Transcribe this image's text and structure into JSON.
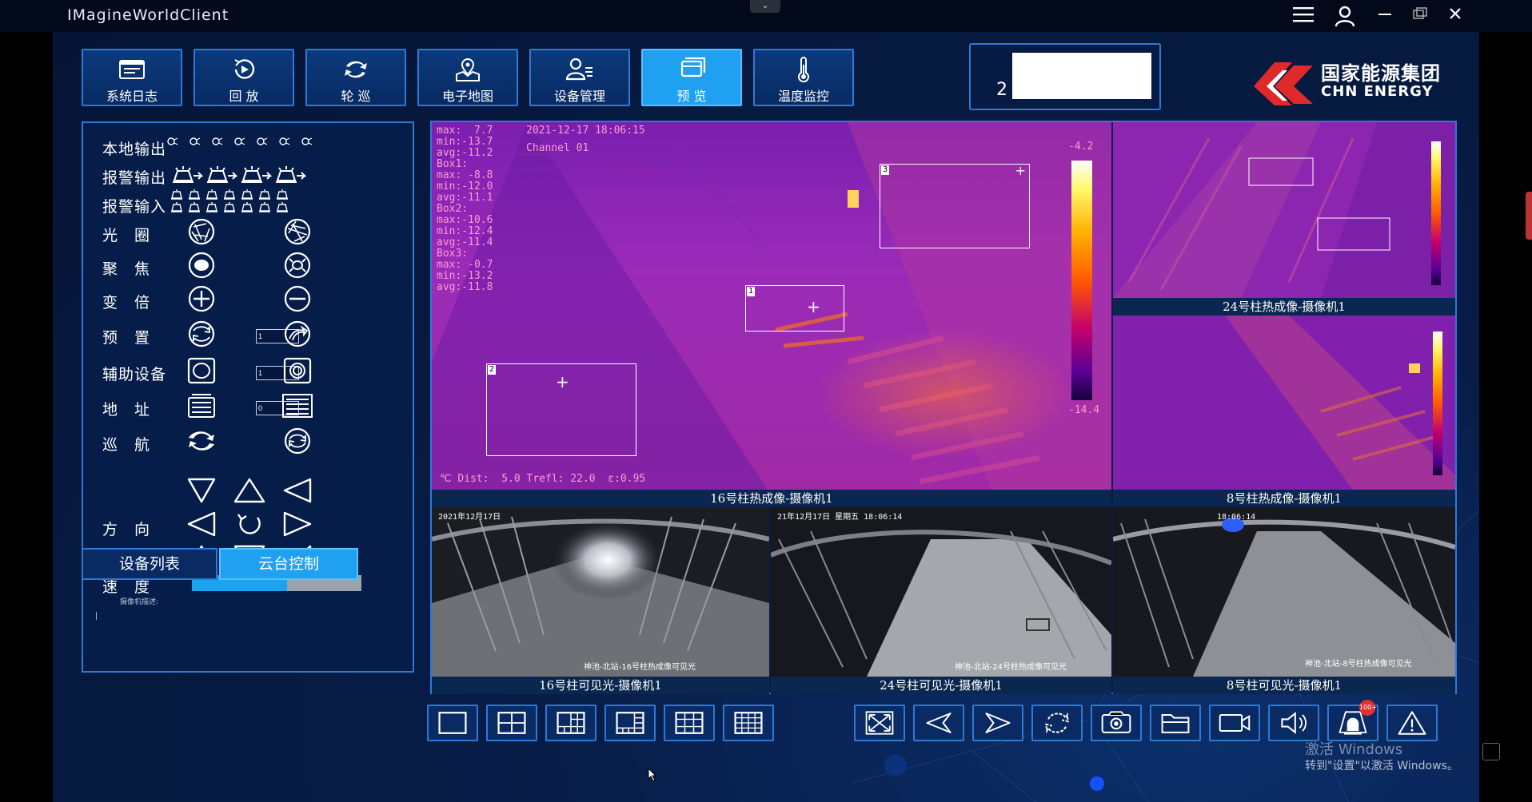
{
  "window": {
    "title": "IMagineWorldClient"
  },
  "nav": [
    {
      "label": "系统日志",
      "icon": "system-log-icon"
    },
    {
      "label": "回 放",
      "icon": "playback-icon"
    },
    {
      "label": "轮 巡",
      "icon": "patrol-icon"
    },
    {
      "label": "电子地图",
      "icon": "map-icon"
    },
    {
      "label": "设备管理",
      "icon": "device-manage-icon"
    },
    {
      "label": "预 览",
      "icon": "preview-icon",
      "active": true
    },
    {
      "label": "温度监控",
      "icon": "thermometer-icon"
    }
  ],
  "id_box": {
    "text": "2"
  },
  "logo": {
    "cn": "国家能源集团",
    "en": "CHN ENERGY",
    "color": "#e02a2a"
  },
  "ptz": {
    "rows": {
      "local_output": "本地输出",
      "alarm_output": "报警输出",
      "alarm_input": "报警输入",
      "iris": "光　圈",
      "focus": "聚　焦",
      "zoom": "变　倍",
      "preset": "预　置",
      "aux": "辅助设备",
      "address": "地　址",
      "cruise": "巡　航",
      "direction": "方　向",
      "speed": "速　度"
    },
    "preset_value": "1",
    "aux_value": "1",
    "address_value": "0",
    "speed_fraction": 0.56,
    "camera_desc": "摄像机描述:"
  },
  "tabs": {
    "device_list": "设备列表",
    "ptz_control": "云台控制"
  },
  "videos": {
    "main": {
      "label": "16号柱热成像-摄像机1",
      "osd_stats": "max:  7.7\nmin:-13.7\navg:-11.2\nBox1:\nmax: -8.8\nmin:-12.0\navg:-11.1\nBox2:\nmax:-10.6\nmin:-12.4\navg:-11.4\nBox3:\nmax: -0.7\nmin:-13.2\navg:-11.8",
      "datetime": "2021-12-17 18:06:15",
      "channel": "Channel 01",
      "scale_max": "-4.2",
      "scale_min": "-14.4",
      "footer": "℃ Dist:  5.0 Trefl: 22.0  ε:0.95",
      "box_1": "1",
      "box_2": "2",
      "box_3": "3"
    },
    "thermal_24": {
      "label": "24号柱热成像-摄像机1"
    },
    "thermal_8": {
      "label": "8号柱热成像-摄像机1"
    },
    "visible_16": {
      "label": "16号柱可见光-摄像机1",
      "stamp": "2021年12月17日",
      "caption": "神池-北站-16号柱热成像可见光"
    },
    "visible_24": {
      "label": "24号柱可见光-摄像机1",
      "stamp": "21年12月17日 星期五 18:06:14",
      "caption": "神池-北站-24号柱热成像可见光"
    },
    "visible_8": {
      "label": "8号柱可见光-摄像机1",
      "stamp": "18:06:14",
      "caption": "神池-北站-8号柱热成像可见光"
    }
  },
  "toolbar": {
    "alarm_badge": "100+"
  },
  "watermark": {
    "line1": "激活 Windows",
    "line2": "转到\"设置\"以激活 Windows。"
  }
}
